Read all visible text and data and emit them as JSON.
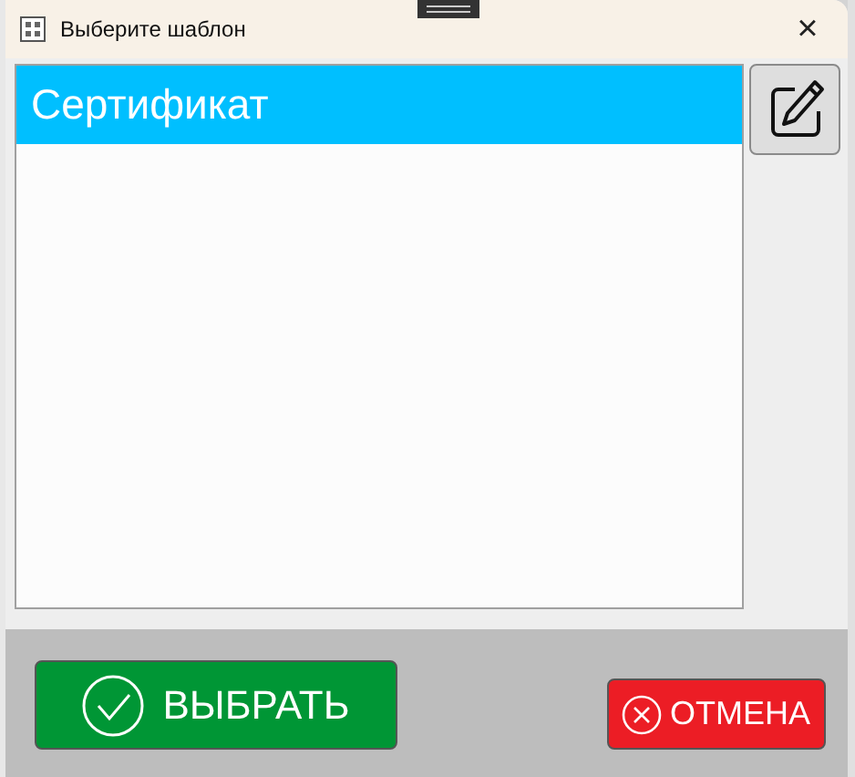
{
  "window": {
    "title": "Выберите шаблон",
    "close": "×"
  },
  "templates": [
    {
      "label": "Сертификат",
      "selected": true
    }
  ],
  "buttons": {
    "select": "ВЫБРАТЬ",
    "cancel": "ОТМЕНА"
  }
}
